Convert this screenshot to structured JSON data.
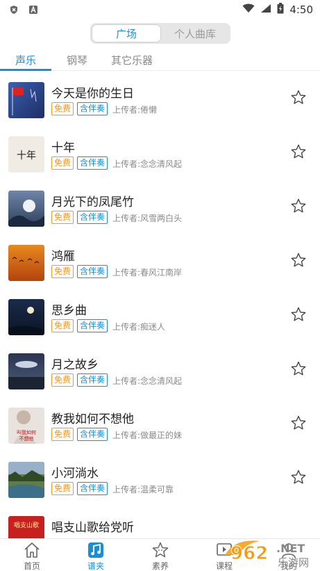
{
  "status": {
    "time": "4:50"
  },
  "segment": {
    "items": [
      "广场",
      "个人曲库"
    ],
    "active": 0
  },
  "tabs": [
    "声乐",
    "钢琴",
    "其它乐器"
  ],
  "badges": {
    "free": "免费",
    "accompaniment": "含伴奏"
  },
  "songs": [
    {
      "title": "今天是你的生日",
      "uploader": "上传者:倦懒"
    },
    {
      "title": "十年",
      "uploader": "上传者:念念清风起"
    },
    {
      "title": "月光下的凤尾竹",
      "uploader": "上传者:风雪两白头"
    },
    {
      "title": "鸿雁",
      "uploader": "上传者:春风江南岸"
    },
    {
      "title": "思乡曲",
      "uploader": "上传者:痴迷人"
    },
    {
      "title": "月之故乡",
      "uploader": "上传者:念念清风起"
    },
    {
      "title": "教我如何不想他",
      "uploader": "上传者:做最正的妹"
    },
    {
      "title": "小河淌水",
      "uploader": "上传者:温柔可靠"
    },
    {
      "title": "唱支山歌给党听",
      "uploader": ""
    }
  ],
  "thumb_text": {
    "t2": "十年",
    "t7": "叫我如何\n不想他",
    "t9": "唱支山歌"
  },
  "nav": [
    "首页",
    "谱夹",
    "素养",
    "课程",
    "我的"
  ],
  "watermark": {
    "brand": "962",
    "suffix": ".NET",
    "site": "乐游网"
  },
  "colors": {
    "accent": "#1a8fd6",
    "free": "#f09a2a"
  }
}
